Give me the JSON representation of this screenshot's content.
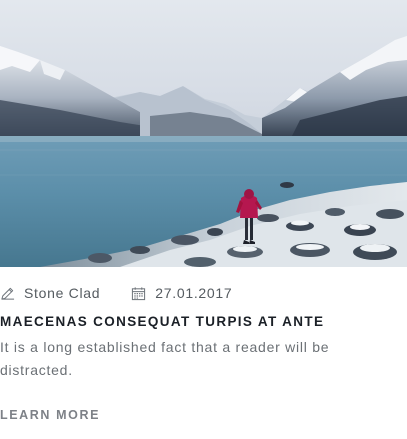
{
  "post": {
    "image_alt": "Person in red jacket standing on a snowy rocky shore of a mountain lake",
    "author": "Stone Clad",
    "author_icon": "pencil-icon",
    "date": "27.01.2017",
    "date_icon": "calendar-icon",
    "title": "MAECENAS CONSEQUAT TURPIS AT ANTE",
    "excerpt": "It is a long established fact that a reader will be distracted.",
    "more_label": "LEARN MORE"
  },
  "colors": {
    "title": "#1b2027",
    "meta": "#555b60",
    "excerpt": "#6b7075",
    "more": "#7d8187",
    "jacket": "#b5174f"
  }
}
